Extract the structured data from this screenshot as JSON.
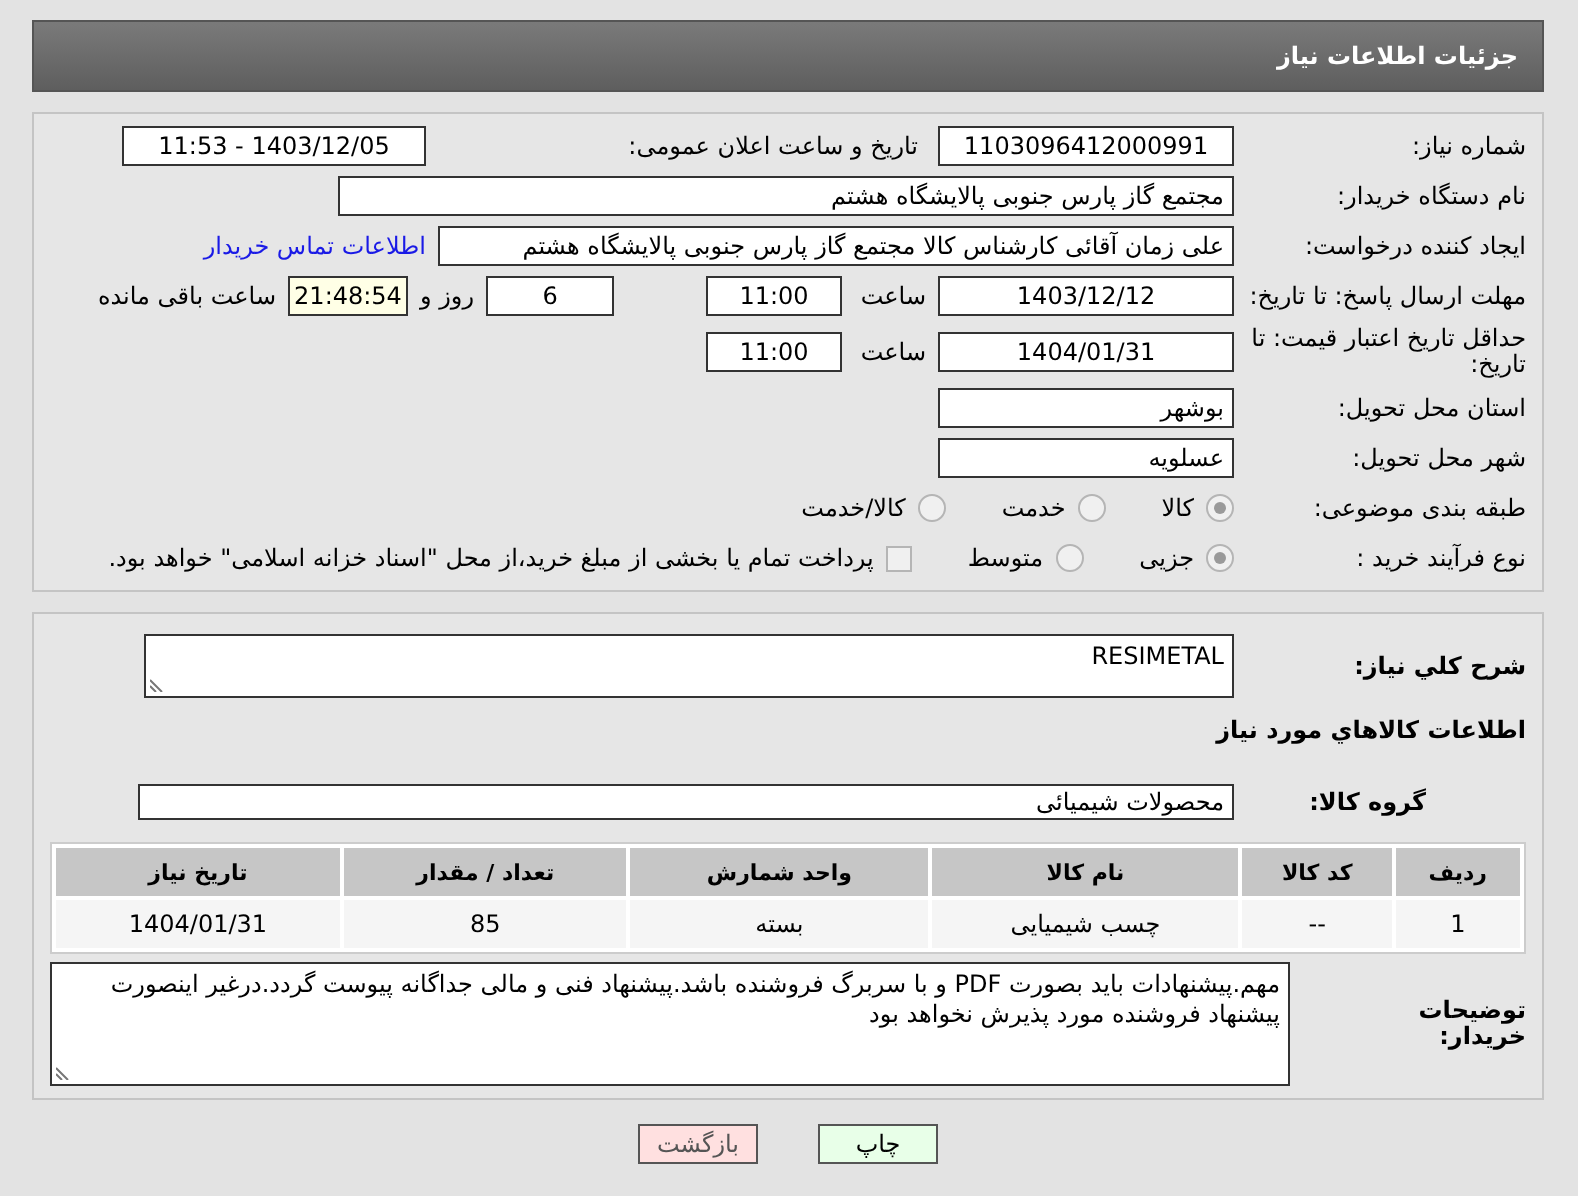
{
  "header": {
    "title": "جزئیات اطلاعات نیاز"
  },
  "need_number": {
    "label": "شماره نیاز:",
    "value": "1103096412000991"
  },
  "announce": {
    "label": "تاریخ و ساعت اعلان عمومی:",
    "value": "1403/12/05 - 11:53"
  },
  "buyer": {
    "label": "نام دستگاه خریدار:",
    "value": "مجتمع گاز پارس جنوبی  پالایشگاه هشتم"
  },
  "creator": {
    "label": "ایجاد کننده درخواست:",
    "value": "علی زمان آقائی کارشناس کالا مجتمع گاز پارس جنوبی  پالایشگاه هشتم",
    "link": "اطلاعات تماس خریدار"
  },
  "reply_deadline": {
    "label": "مهلت ارسال پاسخ: تا تاریخ:",
    "date": "1403/12/12",
    "time_label": "ساعت",
    "time": "11:00",
    "days": "6",
    "days_label": "روز و",
    "remaining": "21:48:54",
    "remaining_label": "ساعت باقی مانده"
  },
  "price_validity": {
    "label": "حداقل تاریخ اعتبار قیمت: تا تاریخ:",
    "date": "1404/01/31",
    "time_label": "ساعت",
    "time": "11:00"
  },
  "province": {
    "label": "استان محل تحویل:",
    "value": "بوشهر"
  },
  "city": {
    "label": "شهر محل تحویل:",
    "value": "عسلویه"
  },
  "category": {
    "label": "طبقه بندی موضوعی:",
    "options": [
      {
        "label": "کالا",
        "selected": true
      },
      {
        "label": "خدمت",
        "selected": false
      },
      {
        "label": "کالا/خدمت",
        "selected": false
      }
    ]
  },
  "process": {
    "label": "نوع فرآیند خرید :",
    "options": [
      {
        "label": "جزیی",
        "selected": true
      },
      {
        "label": "متوسط",
        "selected": false
      }
    ],
    "payment": {
      "label": "پرداخت تمام یا بخشی از مبلغ خرید،از محل \"اسناد خزانه اسلامی\" خواهد بود.",
      "checked": false
    }
  },
  "description": {
    "label": "شرح کلي نیاز:",
    "value": "RESIMETAL"
  },
  "goods_title": "اطلاعات کالاهاي مورد نیاز",
  "goods_group": {
    "label": "گروه کالا:",
    "value": "محصولات شیمیائی"
  },
  "table": {
    "columns": [
      "ردیف",
      "کد کالا",
      "نام کالا",
      "واحد شمارش",
      "تعداد / مقدار",
      "تاریخ نیاز"
    ],
    "rows": [
      [
        "1",
        "--",
        "چسب شیمیایی",
        "بسته",
        "85",
        "1404/01/31"
      ]
    ]
  },
  "buyer_notes": {
    "label": "توضیحات خریدار:",
    "value": "مهم.پیشنهادات باید بصورت PDF و با سربرگ فروشنده باشد.پیشنهاد فنی و مالی جداگانه پیوست گردد.درغیر اینصورت پیشنهاد فروشنده مورد پذیرش نخواهد بود"
  },
  "buttons": [
    {
      "label": "چاپ",
      "kind": "print"
    },
    {
      "label": "بازگشت",
      "kind": "back"
    }
  ]
}
